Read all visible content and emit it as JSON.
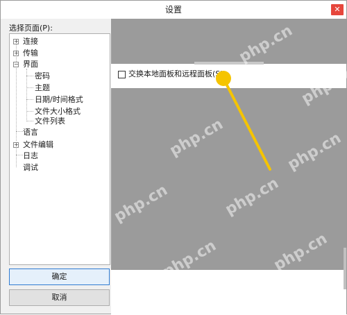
{
  "window": {
    "title": "设置",
    "close_glyph": "✕"
  },
  "sidebar": {
    "label": "选择页面(P):",
    "items": [
      {
        "label": "连接"
      },
      {
        "label": "传输"
      },
      {
        "label": "界面"
      },
      {
        "label": "密码"
      },
      {
        "label": "主题"
      },
      {
        "label": "日期/时间格式"
      },
      {
        "label": "文件大小格式"
      },
      {
        "label": "文件列表"
      },
      {
        "label": "语言"
      },
      {
        "label": "文件编辑"
      },
      {
        "label": "日志"
      },
      {
        "label": "调试"
      }
    ]
  },
  "buttons": {
    "ok": "确定",
    "cancel": "取消"
  },
  "option": {
    "swap_panels": "交换本地面板和远程面板(S)"
  },
  "watermark": "php.cn",
  "colors": {
    "accent": "#f5c400",
    "dim": "#9b9b9b",
    "close": "#e6463c"
  }
}
